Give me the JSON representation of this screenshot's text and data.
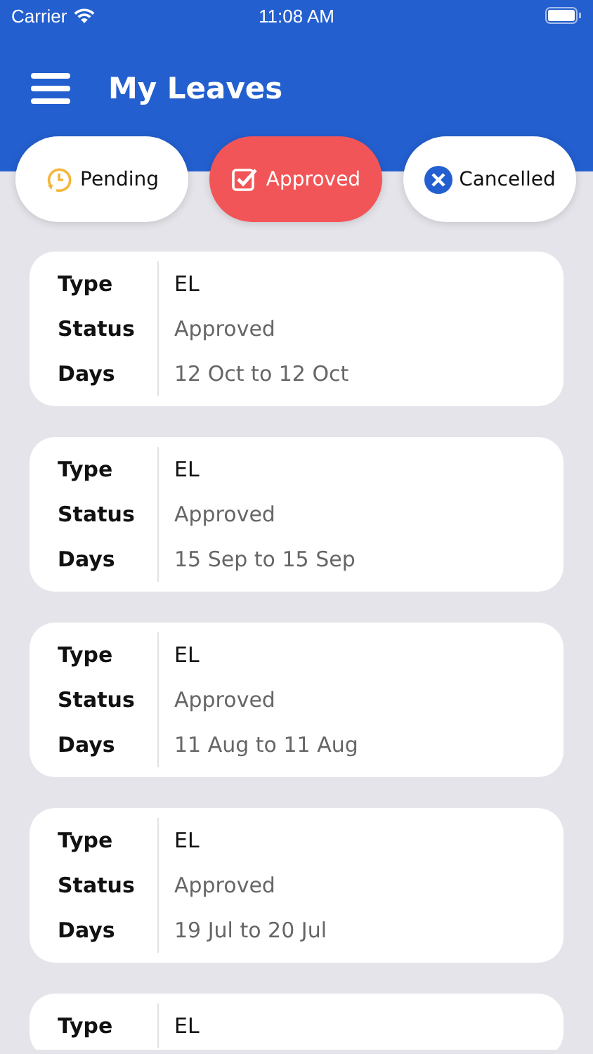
{
  "status_bar": {
    "carrier": "Carrier",
    "time": "11:08 AM"
  },
  "header": {
    "title": "My Leaves"
  },
  "tabs": [
    {
      "label": "Pending",
      "kind": "pending",
      "selected": false
    },
    {
      "label": "Approved",
      "kind": "approved",
      "selected": true
    },
    {
      "label": "Cancelled",
      "kind": "cancelled",
      "selected": false
    }
  ],
  "leaves": [
    {
      "fields": [
        {
          "label": "Type",
          "value": "EL",
          "kind": "strong"
        },
        {
          "label": "Status",
          "value": "Approved",
          "kind": "muted"
        },
        {
          "label": "Days",
          "value": "12 Oct to 12 Oct",
          "kind": "muted"
        }
      ]
    },
    {
      "fields": [
        {
          "label": "Type",
          "value": "EL",
          "kind": "strong"
        },
        {
          "label": "Status",
          "value": "Approved",
          "kind": "muted"
        },
        {
          "label": "Days",
          "value": "15 Sep to 15 Sep",
          "kind": "muted"
        }
      ]
    },
    {
      "fields": [
        {
          "label": "Type",
          "value": "EL",
          "kind": "strong"
        },
        {
          "label": "Status",
          "value": "Approved",
          "kind": "muted"
        },
        {
          "label": "Days",
          "value": "11 Aug to 11 Aug",
          "kind": "muted"
        }
      ]
    },
    {
      "fields": [
        {
          "label": "Type",
          "value": "EL",
          "kind": "strong"
        },
        {
          "label": "Status",
          "value": "Approved",
          "kind": "muted"
        },
        {
          "label": "Days",
          "value": "19 Jul to 20 Jul",
          "kind": "muted"
        }
      ]
    },
    {
      "fields": [
        {
          "label": "Type",
          "value": "EL",
          "kind": "strong"
        }
      ]
    }
  ]
}
